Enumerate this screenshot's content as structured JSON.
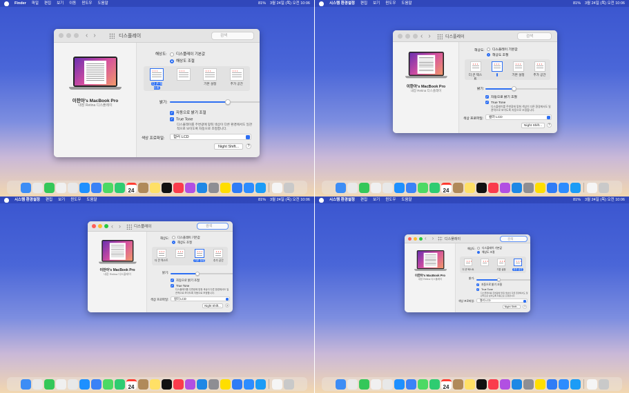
{
  "menubar": {
    "left_main": [
      "Finder",
      "파일",
      "편집",
      "보기",
      "이동",
      "윈도우",
      "도움말"
    ],
    "left_prefs": [
      "시스템 환경설정",
      "편집",
      "보기",
      "윈도우",
      "도움말"
    ],
    "battery": "81%",
    "datetime": "3월 24일 (목) 오전 10:06"
  },
  "window": {
    "title": "디스플레이",
    "back": "‹",
    "forward": "›",
    "search_placeholder": "검색"
  },
  "device": {
    "name": "이한아's MacBook Pro",
    "subtitle": "내장 Retina 디스플레이"
  },
  "settings": {
    "resolution_label": "해상도:",
    "res_option_default": "디스플레이 기본값",
    "res_option_scaled": "해상도 조절",
    "presets": [
      "더 큰 텍스트",
      "",
      "기본 설정",
      "추가 공간"
    ],
    "brightness_label": "밝기:",
    "brightness_value": 0.62,
    "auto_brightness": "자동으로 밝기 조절",
    "true_tone": "True Tone",
    "true_tone_desc": "디스플레이를 주변광에 맞춰 색상이 다른 환경에서도 일관적으로 보이도록 자동으로 조정합니다.",
    "color_profile_label": "색상 프로파일:",
    "color_profile_value": "컬러 LCD",
    "night_shift": "Night Shift...",
    "help": "?"
  },
  "dock": {
    "icons": [
      "finder-icon",
      "launchpad-icon",
      "messages-icon",
      "photos-icon",
      "chrome-icon",
      "safari-icon",
      "mail-icon",
      "maps-icon",
      "facetime-icon",
      "calendar-icon",
      "contacts-icon",
      "notes-icon",
      "appletv-icon",
      "music-icon",
      "podcasts-icon",
      "appstore-icon",
      "settings-icon",
      "kakaotalk-icon",
      "tasks-icon",
      "zoom-icon",
      "xcode-icon",
      "documents-icon",
      "trash-icon"
    ],
    "colors": [
      "#3d8df5",
      "#e9e9e9",
      "#34c759",
      "#f0f0f0",
      "#e8e8e8",
      "#1e90ff",
      "#3b82f6",
      "#4cd964",
      "#2ecc71",
      "#ffffff",
      "#b08a5a",
      "#ffe066",
      "#111111",
      "#fa3c4c",
      "#b150e2",
      "#1e88e5",
      "#8e8e93",
      "#ffde00",
      "#2f7cf6",
      "#2d8cff",
      "#1c9cf6",
      "#f5f5f5",
      "#c9c9c9"
    ],
    "calendar_day": "24"
  }
}
